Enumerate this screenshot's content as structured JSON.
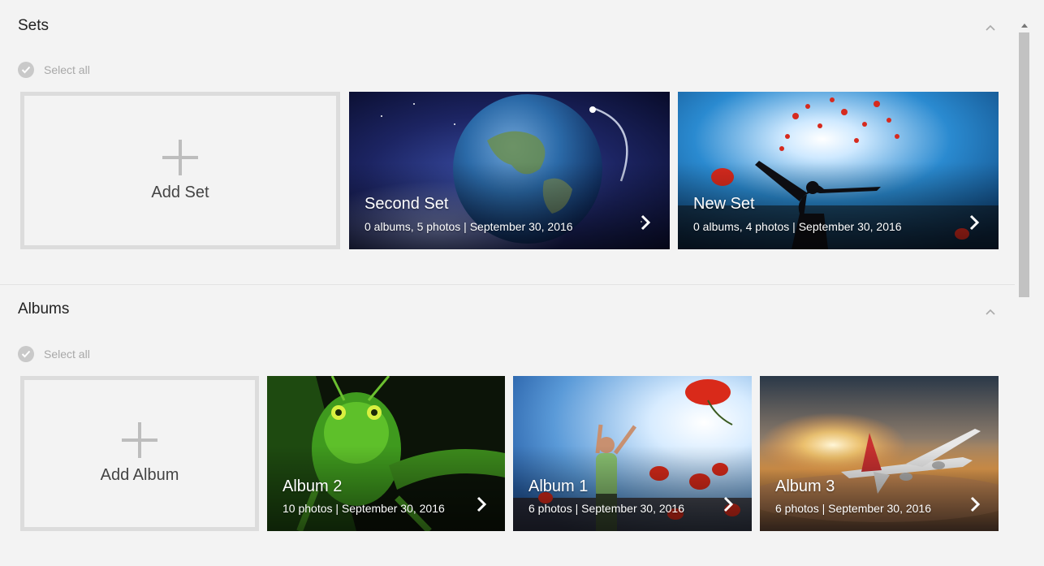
{
  "sets": {
    "title": "Sets",
    "select_all": "Select all",
    "add_label": "Add Set",
    "items": [
      {
        "title": "Second Set",
        "meta": "0 albums, 5 photos | September 30, 2016",
        "scene": "earth-space"
      },
      {
        "title": "New Set",
        "meta": "0 albums, 4 photos | September 30, 2016",
        "scene": "sky-poppies-person"
      }
    ]
  },
  "albums": {
    "title": "Albums",
    "select_all": "Select all",
    "add_label": "Add Album",
    "items": [
      {
        "title": "Album 2",
        "meta": "10 photos | September 30, 2016",
        "scene": "grasshopper"
      },
      {
        "title": "Album 1",
        "meta": "6 photos | September 30, 2016",
        "scene": "woman-poppies"
      },
      {
        "title": "Album 3",
        "meta": "6 photos | September 30, 2016",
        "scene": "airplane-sunset"
      }
    ]
  }
}
